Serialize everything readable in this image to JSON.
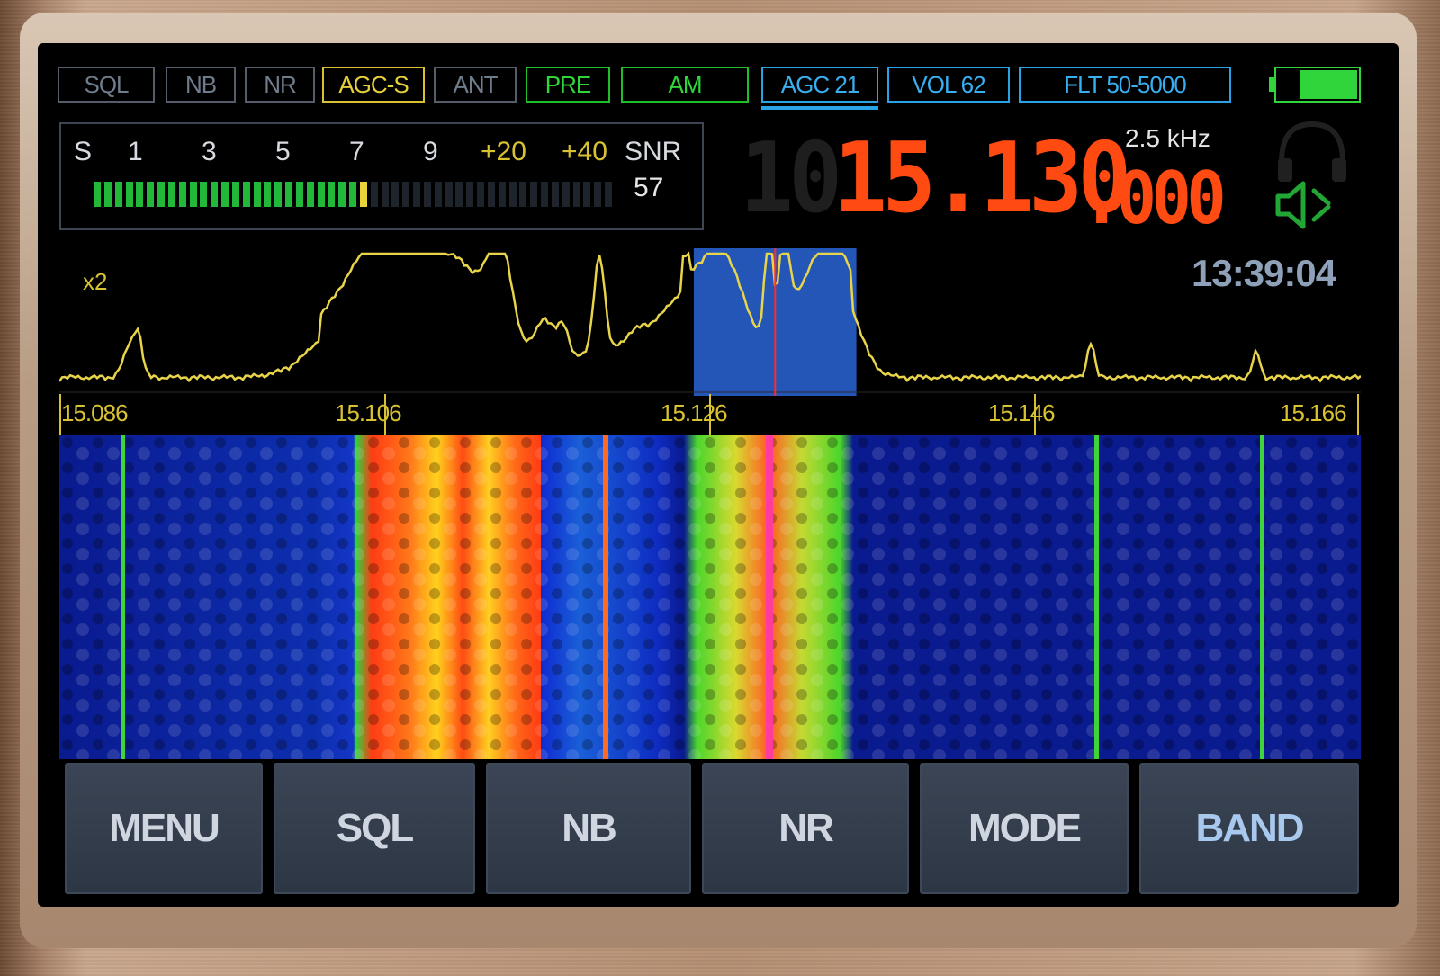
{
  "status_buttons": {
    "sql": "SQL",
    "nb": "NB",
    "nr": "NR",
    "agc_s": "AGC-S",
    "ant": "ANT",
    "pre": "PRE",
    "mode": "AM",
    "agc": "AGC 21",
    "vol": "VOL 62",
    "flt": "FLT 50-5000"
  },
  "smeter": {
    "scale_labels": [
      "S",
      "1",
      "3",
      "5",
      "7",
      "9",
      "+20",
      "+40"
    ],
    "snr_label": "SNR",
    "snr_value": "57",
    "level_segments_lit": 26,
    "total_segments": 49
  },
  "frequency": {
    "ghost_digit": "10",
    "main": "15.130",
    "sub": ".000",
    "step": "2.5 kHz"
  },
  "spectrum": {
    "zoom": "x2",
    "clock": "13:39:04",
    "scale_labels": [
      "15.086",
      "15.106",
      "15.126",
      "15.146",
      "15.166"
    ],
    "span_mhz": [
      15.086,
      15.166
    ],
    "center_mhz": 15.13,
    "passband_mhz": [
      15.125,
      15.135
    ]
  },
  "soft_keys": [
    "MENU",
    "SQL",
    "NB",
    "NR",
    "MODE",
    "BAND"
  ],
  "colors": {
    "freq": "#ff4a12",
    "trace": "#e8d44a",
    "passband": "#2456b8",
    "marker": "#ff2a2a"
  }
}
